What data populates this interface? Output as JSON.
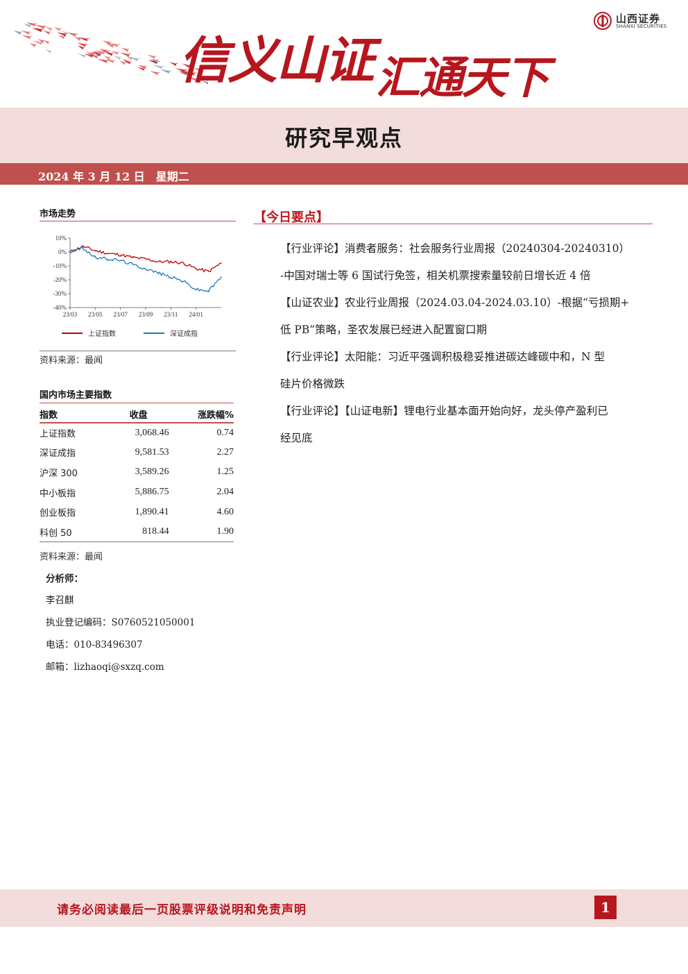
{
  "header": {
    "slogan_part1": "信义山证",
    "slogan_part2": "汇通天下",
    "logo_name": "山西证券",
    "logo_en": "SHANXI SECURITIES"
  },
  "title": "研究早观点",
  "date": {
    "text": "2024 年 3 月 12 日",
    "weekday": "星期二"
  },
  "market": {
    "heading": "市场走势",
    "source": "资料来源：最闻"
  },
  "chart_data": {
    "type": "line",
    "x": [
      "23/03",
      "23/04",
      "23/05",
      "23/06",
      "23/07",
      "23/08",
      "23/09",
      "23/10",
      "23/11",
      "23/12",
      "24/01",
      "24/02",
      "24/03"
    ],
    "x_tick_labels": [
      "23/03",
      "23/05",
      "23/07",
      "23/09",
      "23/11",
      "24/01"
    ],
    "y_tick_labels": [
      "10%",
      "0%",
      "-10%",
      "-20%",
      "-30%",
      "-40%"
    ],
    "ylim": [
      -40,
      10
    ],
    "series": [
      {
        "name": "上证指数",
        "color": "#c00000",
        "values": [
          0,
          4,
          1,
          -1,
          -2,
          -4,
          -5,
          -7,
          -7,
          -8,
          -12,
          -14,
          -8
        ]
      },
      {
        "name": "深证成指",
        "color": "#1f77b4",
        "values": [
          0,
          3,
          -4,
          -5,
          -6,
          -9,
          -12,
          -15,
          -18,
          -21,
          -27,
          -28,
          -18
        ]
      }
    ],
    "legend_position": "bottom",
    "grid": false
  },
  "indices": {
    "heading": "国内市场主要指数",
    "columns": [
      "指数",
      "收盘",
      "涨跌幅%"
    ],
    "rows": [
      {
        "name": "上证指数",
        "close": "3,068.46",
        "change": "0.74"
      },
      {
        "name": "深证成指",
        "close": "9,581.53",
        "change": "2.27"
      },
      {
        "name": "沪深 300",
        "close": "3,589.26",
        "change": "1.25"
      },
      {
        "name": "中小板指",
        "close": "5,886.75",
        "change": "2.04"
      },
      {
        "name": "创业板指",
        "close": "1,890.41",
        "change": "4.60"
      },
      {
        "name": "科创 50",
        "close": "818.44",
        "change": "1.90"
      }
    ],
    "source": "资料来源：最闻"
  },
  "analyst": {
    "heading": "分析师：",
    "name": "李召麒",
    "reg": "执业登记编码：S0760521050001",
    "phone": "电话：010-83496307",
    "email": "邮箱：lizhaoqi@sxzq.com"
  },
  "key_points": {
    "title": "【今日要点】",
    "items": [
      {
        "line1": "【行业评论】消费者服务：社会服务行业周报（20240304-20240310）",
        "line2": "-中国对瑞士等 6 国试行免签，相关机票搜索量较前日增长近 4 倍"
      },
      {
        "line1": "【山证农业】农业行业周报（2024.03.04-2024.03.10）-根据“亏损期+",
        "line2": "低 PB”策略，圣农发展已经进入配置窗口期"
      },
      {
        "line1": "【行业评论】太阳能：习近平强调积极稳妥推进碳达峰碳中和，N 型",
        "line2": "硅片价格微跌"
      },
      {
        "line1": "【行业评论】【山证电新】锂电行业基本面开始向好，龙头停产盈利已",
        "line2": "经见底"
      }
    ]
  },
  "footer": {
    "disclaimer": "请务必阅读最后一页股票评级说明和免责声明",
    "page": "1"
  }
}
